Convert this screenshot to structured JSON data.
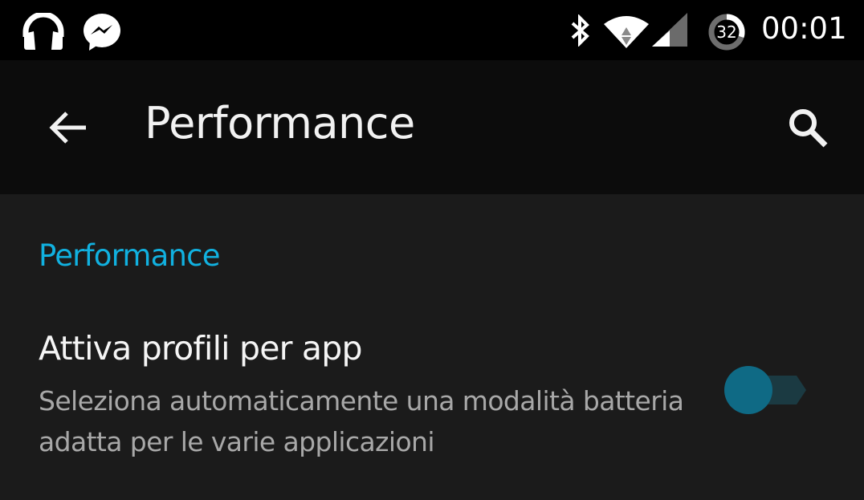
{
  "status_bar": {
    "notification_icons": [
      "headphones-icon",
      "messenger-icon"
    ],
    "system_icons": [
      "bluetooth-icon",
      "wifi-icon",
      "cell-signal-icon",
      "battery-icon"
    ],
    "battery_level": "32",
    "time": "00:01"
  },
  "toolbar": {
    "back_icon": "arrow-left-icon",
    "title": "Performance",
    "search_icon": "search-icon"
  },
  "content": {
    "section_header": "Performance",
    "preferences": [
      {
        "title": "Attiva profili per app",
        "summary": "Seleziona automaticamente una modalità batteria adatta per le varie applicazioni",
        "switch_on": false
      }
    ]
  },
  "colors": {
    "accent": "#11b1e0",
    "switch_thumb": "#0f6a85",
    "switch_track": "#1b3a42",
    "toolbar_bg": "#0c0c0c",
    "content_bg": "#1b1b1b",
    "status_bar_bg": "#000000"
  }
}
